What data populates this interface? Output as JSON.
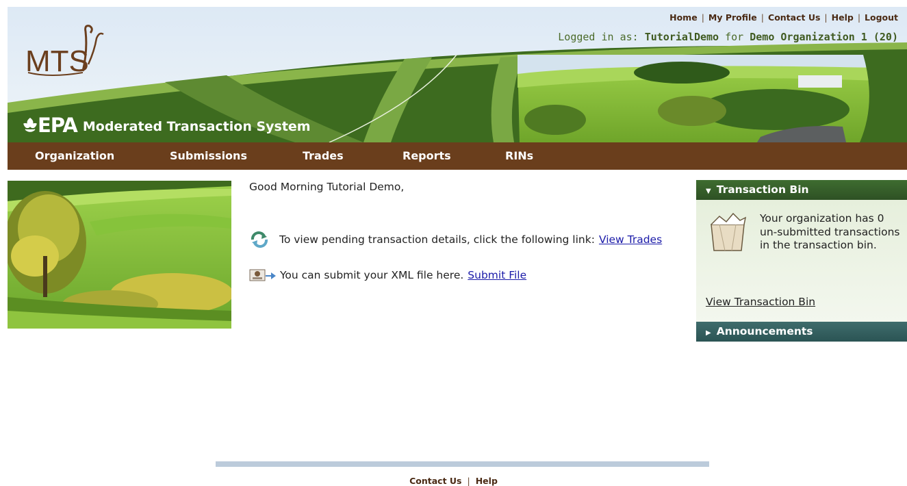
{
  "header": {
    "top_links": [
      "Home",
      "My Profile",
      "Contact Us",
      "Help",
      "Logout"
    ],
    "login_prefix": "Logged in as: ",
    "user": "TutorialDemo",
    "login_for": " for ",
    "organization": "Demo Organization 1 (20)",
    "logo_text": "MTS",
    "epa_text": "EPA",
    "system_name": "Moderated Transaction System"
  },
  "nav": [
    "Organization",
    "Submissions",
    "Trades",
    "Reports",
    "RINs"
  ],
  "main": {
    "greeting": "Good Morning Tutorial Demo,",
    "pending_text": "To view pending transaction details, click the following link:",
    "pending_link": "View Trades",
    "submit_text": "You can submit your XML file here.",
    "submit_link": "Submit File"
  },
  "right_panel": {
    "bin_title": "Transaction Bin",
    "bin_message": "Your organization has 0 un-submitted transactions in the transaction bin.",
    "bin_link": "View Transaction Bin",
    "announcements_title": "Announcements"
  },
  "footer": {
    "links": [
      "Contact Us",
      "Help"
    ]
  },
  "colors": {
    "nav_bg": "#6a3e1c",
    "header_green": "#3d6b1f",
    "link_blue": "#1a1aa8"
  }
}
